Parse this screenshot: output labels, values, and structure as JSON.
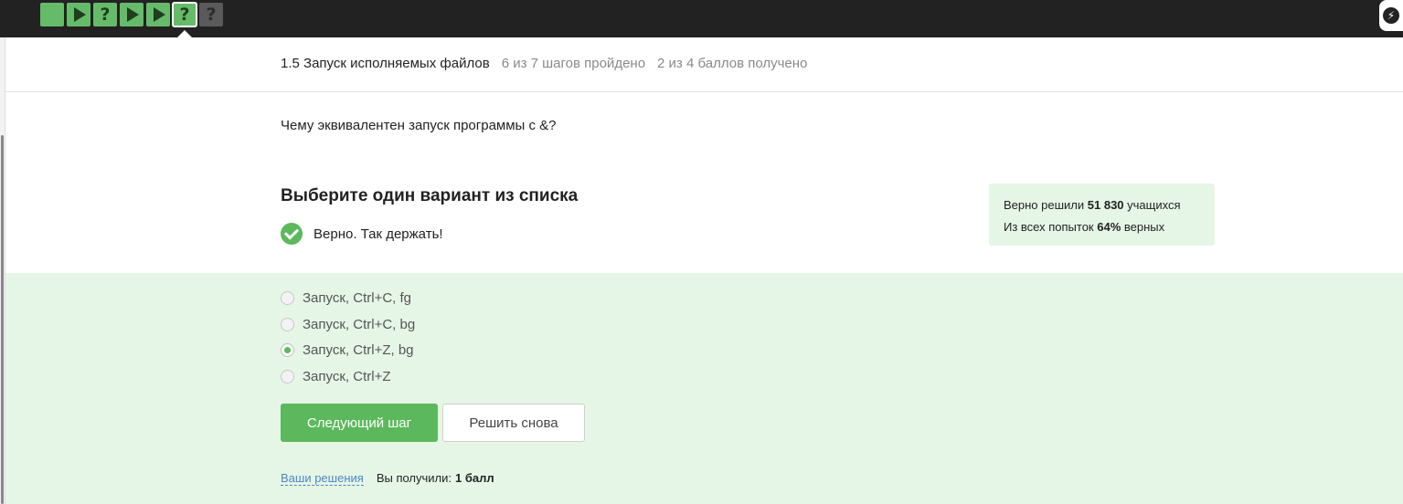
{
  "steps": [
    {
      "kind": "solved-blank",
      "icon": "solved-step-icon"
    },
    {
      "kind": "play",
      "icon": "play-icon"
    },
    {
      "kind": "question",
      "icon": "question-icon",
      "label": "?"
    },
    {
      "kind": "play",
      "icon": "play-icon"
    },
    {
      "kind": "play",
      "icon": "play-icon"
    },
    {
      "kind": "question-current",
      "icon": "question-icon",
      "label": "?"
    },
    {
      "kind": "question-unsolved",
      "icon": "question-icon",
      "label": "?"
    }
  ],
  "header": {
    "lesson": "1.5 Запуск исполняемых файлов",
    "progress": "6 из 7 шагов пройдено",
    "points": "2 из 4 баллов  получено"
  },
  "question": "Чему эквивалентен запуск программы с &?",
  "choose_title": "Выберите один вариант из списка",
  "feedback": "Верно. Так держать!",
  "stats": {
    "line1_prefix": "Верно решили ",
    "line1_value": "51 830",
    "line1_suffix": " учащихся",
    "line2_prefix": "Из всех попыток ",
    "line2_value": "64%",
    "line2_suffix": " верных"
  },
  "options": [
    {
      "label": "Запуск, Ctrl+C, fg",
      "selected": false
    },
    {
      "label": "Запуск, Ctrl+C, bg",
      "selected": false
    },
    {
      "label": "Запуск, Ctrl+Z, bg",
      "selected": true
    },
    {
      "label": "Запуск, Ctrl+Z",
      "selected": false
    }
  ],
  "buttons": {
    "next": "Следующий шаг",
    "again": "Решить снова"
  },
  "footer": {
    "solutions_link": "Ваши решения",
    "received_label": "Вы получили:",
    "received_value": "1 балл"
  },
  "colors": {
    "accent": "#5cb85c",
    "solved_step": "#66bb6a",
    "feedback_bg": "#e6f6e6",
    "topbar": "#222222",
    "link": "#4a86c5"
  }
}
